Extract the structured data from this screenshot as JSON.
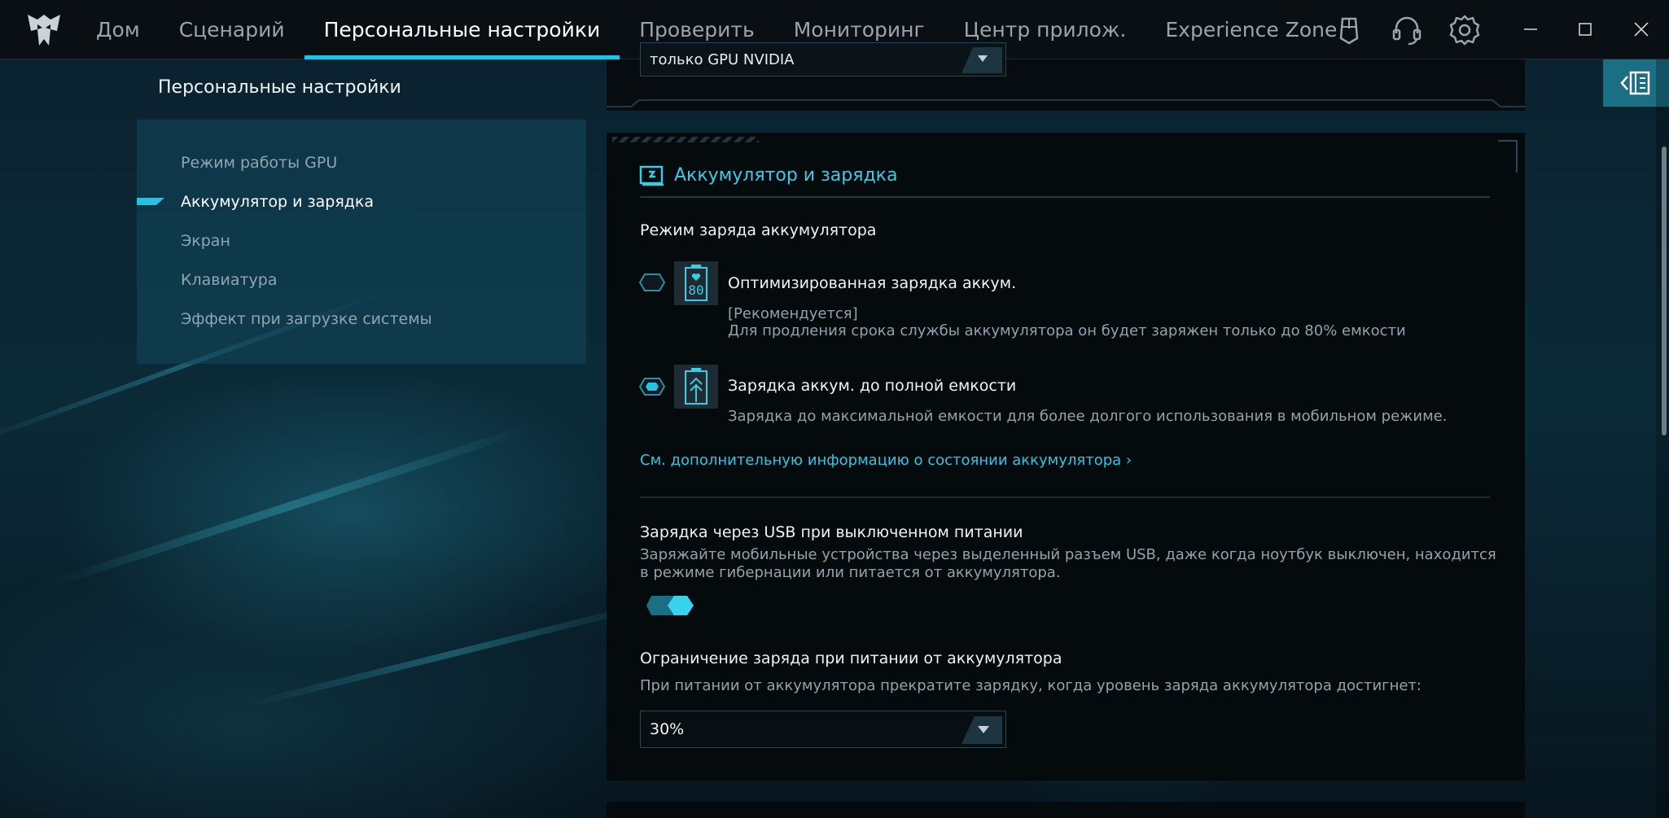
{
  "nav": {
    "items": [
      "Дом",
      "Сценарий",
      "Персональные настройки",
      "Проверить",
      "Мониторинг",
      "Центр прилож.",
      "Experience Zone"
    ],
    "active_index": 2
  },
  "icons": {
    "logo": "predator-logo",
    "top_right": [
      "mouse-icon",
      "headset-icon",
      "gear-icon"
    ],
    "window": [
      "minimize-icon",
      "maximize-icon",
      "close-icon"
    ]
  },
  "sidebar": {
    "title": "Персональные настройки",
    "items": [
      {
        "label": "Режим работы GPU"
      },
      {
        "label": "Аккумулятор и зарядка"
      },
      {
        "label": "Экран"
      },
      {
        "label": "Клавиатура"
      },
      {
        "label": "Эффект при загрузке системы"
      }
    ],
    "active_index": 1
  },
  "gpu_card": {
    "select_value": "только GPU NVIDIA"
  },
  "battery": {
    "title": "Аккумулятор и зарядка",
    "charge_mode_label": "Режим заряда аккумулятора",
    "options": [
      {
        "title": "Оптимизированная зарядка аккум.",
        "recommended": "[Рекомендуется]",
        "description": "Для продления срока службы аккумулятора он будет заряжен только до 80% емкости",
        "icon_text": "80",
        "selected": false
      },
      {
        "title": "Зарядка аккум. до полной емкости",
        "description": "Зарядка до максимальной емкости для более долгого использования в мобильном режиме.",
        "selected": true
      }
    ],
    "more_info_link": "См. дополнительную информацию о состоянии аккумулятора ›",
    "usb": {
      "title": "Зарядка через USB при выключенном питании",
      "description_line1": "Заряжайте мобильные устройства через выделенный разъем USB, даже когда ноутбук выключен, находится",
      "description_line2": "в режиме гибернации или питается от аккумулятора.",
      "enabled": true
    },
    "limit": {
      "title": "Ограничение заряда при питании от аккумулятора",
      "description": "При питании от аккумулятора прекратите зарядку, когда уровень заряда аккумулятора достигнет:",
      "value": "30%"
    }
  },
  "colors": {
    "accent": "#21c4e6",
    "background": "#06121a",
    "card": "#050a0d"
  }
}
